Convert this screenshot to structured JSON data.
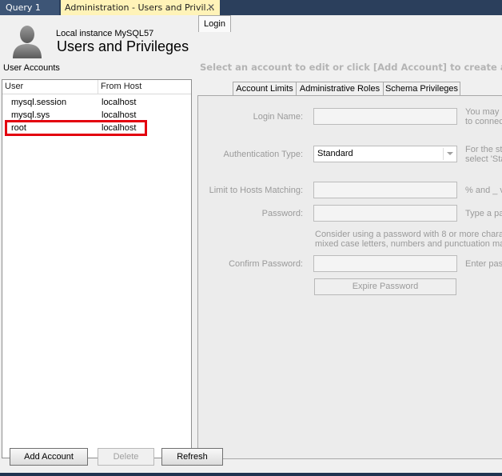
{
  "tabs": [
    {
      "label": "Query 1"
    },
    {
      "label": "Administration - Users and Privil…"
    }
  ],
  "header": {
    "instance": "Local instance MySQL57",
    "title": "Users and Privileges"
  },
  "accounts": {
    "label": "User Accounts",
    "columns": [
      "User",
      "From Host"
    ],
    "rows": [
      {
        "user": "mysql.session",
        "host": "localhost"
      },
      {
        "user": "mysql.sys",
        "host": "localhost"
      },
      {
        "user": "root",
        "host": "localhost"
      }
    ]
  },
  "hint": "Select an account to edit or click [Add Account] to create a new one",
  "detail_tabs": [
    "Login",
    "Account Limits",
    "Administrative Roles",
    "Schema Privileges"
  ],
  "login": {
    "login_name_label": "Login Name:",
    "auth_type_label": "Authentication Type:",
    "auth_type_value": "Standard",
    "hosts_label": "Limit to Hosts Matching:",
    "password_label": "Password:",
    "confirm_label": "Confirm Password:",
    "login_help_1": "You may c",
    "login_help_2": "to connec",
    "auth_help_1": "For the st",
    "auth_help_2": "select 'Sta",
    "hosts_help": "% and _ v",
    "password_help": "Type a pa",
    "password_note_1": "Consider using a password with 8 or more charac",
    "password_note_2": "mixed case letters, numbers and punctuation ma",
    "confirm_help": "Enter pas",
    "expire_button": "Expire Password"
  },
  "buttons": {
    "add": "Add Account",
    "delete": "Delete",
    "refresh": "Refresh"
  },
  "colors": {
    "highlight": "#e3000f",
    "active_tab": "#fff3b8",
    "tabbar": "#2b3f5c"
  }
}
